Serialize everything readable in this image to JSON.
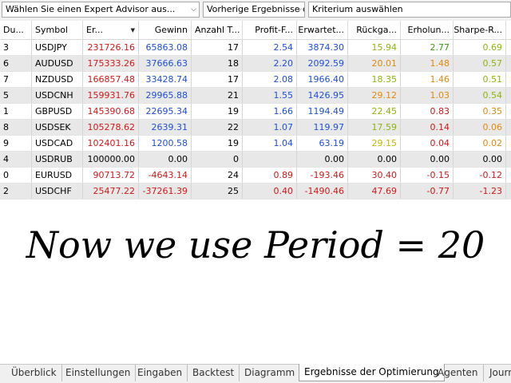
{
  "toolbar": {
    "expert_advisor": "Wählen Sie einen Expert Advisor aus...",
    "previous_results": "Vorherige Ergebnisse d",
    "criterion": "Kriterium auswählen"
  },
  "columns": [
    "Du...",
    "Symbol",
    "Er...",
    "Gewinn",
    "Anzahl T...",
    "Profit-F...",
    "Erwartet...",
    "Rückga...",
    "Erholun...",
    "Sharpe-R..."
  ],
  "rows": [
    [
      "3",
      "USDJPY",
      "231726.16",
      "65863.08",
      "17",
      "2.54",
      "3874.30",
      "15.94",
      "2.77",
      "0.69"
    ],
    [
      "6",
      "AUDUSD",
      "175333.26",
      "37666.63",
      "18",
      "2.20",
      "2092.59",
      "20.01",
      "1.48",
      "0.57"
    ],
    [
      "7",
      "NZDUSD",
      "166857.48",
      "33428.74",
      "17",
      "2.08",
      "1966.40",
      "18.35",
      "1.46",
      "0.51"
    ],
    [
      "5",
      "USDCNH",
      "159931.76",
      "29965.88",
      "21",
      "1.55",
      "1426.95",
      "29.12",
      "1.03",
      "0.54"
    ],
    [
      "1",
      "GBPUSD",
      "145390.68",
      "22695.34",
      "19",
      "1.66",
      "1194.49",
      "22.45",
      "0.83",
      "0.35"
    ],
    [
      "8",
      "USDSEK",
      "105278.62",
      "2639.31",
      "22",
      "1.07",
      "119.97",
      "17.59",
      "0.14",
      "0.06"
    ],
    [
      "9",
      "USDCAD",
      "102401.16",
      "1200.58",
      "19",
      "1.04",
      "63.19",
      "29.15",
      "0.04",
      "0.02"
    ],
    [
      "4",
      "USDRUB",
      "100000.00",
      "0.00",
      "0",
      "",
      "0.00",
      "0.00",
      "0.00",
      "0.00"
    ],
    [
      "0",
      "EURUSD",
      "90713.72",
      "-4643.14",
      "24",
      "0.89",
      "-193.46",
      "30.40",
      "-0.15",
      "-0.12"
    ],
    [
      "2",
      "USDCHF",
      "25477.22",
      "-37261.39",
      "25",
      "0.40",
      "-1490.46",
      "47.69",
      "-0.77",
      "-1.23"
    ]
  ],
  "cell_colors": [
    [
      "black",
      "black",
      "red",
      "blue",
      "black",
      "blue",
      "blue",
      "olive",
      "green",
      "olive"
    ],
    [
      "black",
      "black",
      "red",
      "blue",
      "black",
      "blue",
      "blue",
      "orange",
      "orange",
      "olive"
    ],
    [
      "black",
      "black",
      "red",
      "blue",
      "black",
      "blue",
      "blue",
      "olive",
      "orange",
      "olive"
    ],
    [
      "black",
      "black",
      "red",
      "blue",
      "black",
      "blue",
      "blue",
      "orange",
      "orange",
      "olive"
    ],
    [
      "black",
      "black",
      "red",
      "blue",
      "black",
      "blue",
      "blue",
      "olive",
      "red",
      "orange"
    ],
    [
      "black",
      "black",
      "red",
      "blue",
      "black",
      "blue",
      "blue",
      "olive",
      "red",
      "orange"
    ],
    [
      "black",
      "black",
      "red",
      "blue",
      "black",
      "blue",
      "blue",
      "yellow",
      "red",
      "orange"
    ],
    [
      "black",
      "black",
      "black",
      "black",
      "black",
      "black",
      "black",
      "black",
      "black",
      "black"
    ],
    [
      "black",
      "black",
      "red",
      "red",
      "black",
      "red",
      "red",
      "red",
      "red",
      "red"
    ],
    [
      "black",
      "black",
      "red",
      "red",
      "black",
      "red",
      "red",
      "red",
      "red",
      "red"
    ]
  ],
  "caption": "Now we use Period = 20",
  "tabs": [
    "Überblick",
    "Einstellungen",
    "Eingaben",
    "Backtest",
    "Diagramm",
    "Ergebnisse der Optimierung",
    "Agenten",
    "Journal"
  ],
  "active_tab": 5
}
